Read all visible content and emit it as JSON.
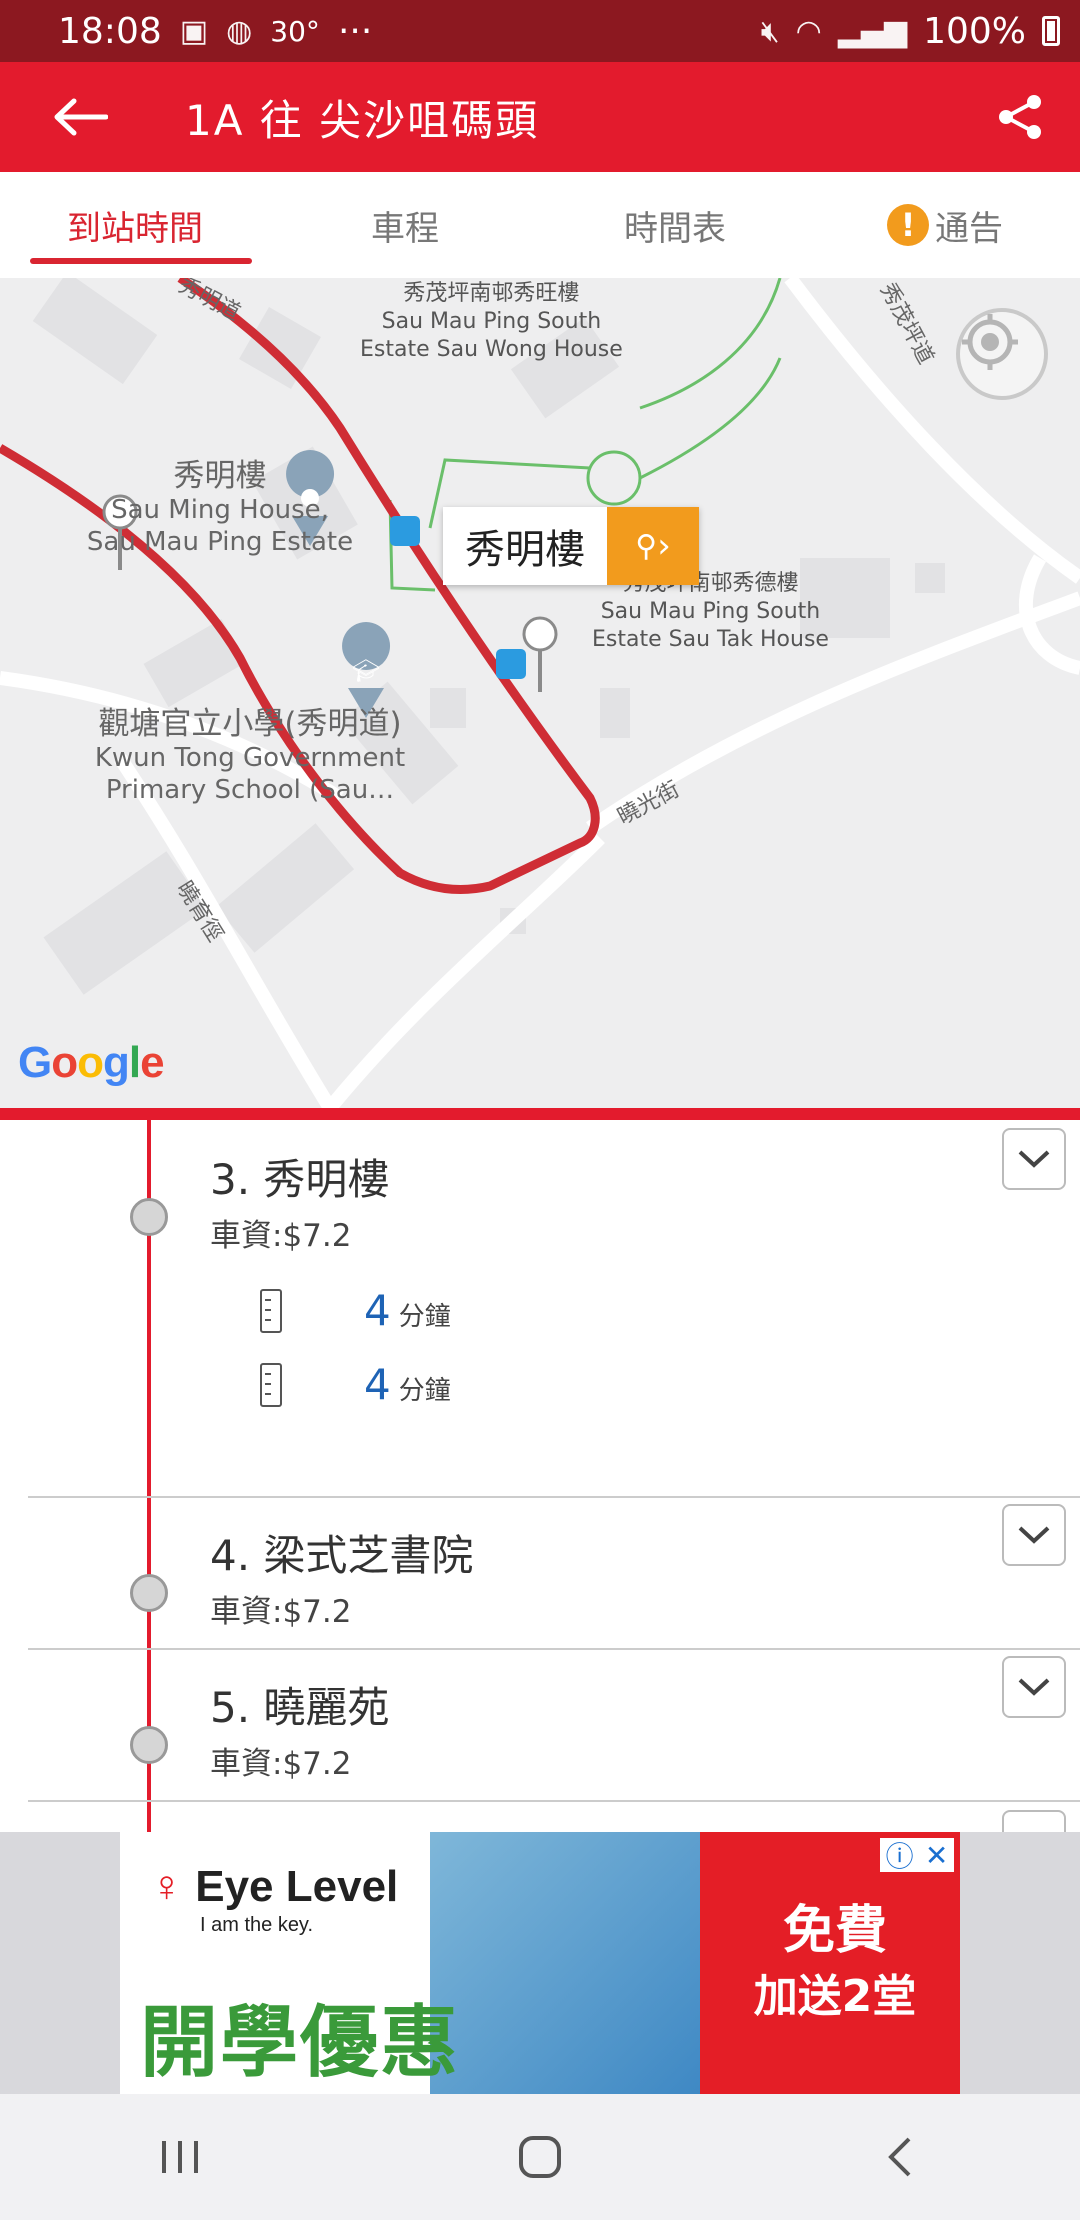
{
  "status_bar": {
    "time": "18:08",
    "temperature": "30°",
    "more": "···",
    "battery": "100%"
  },
  "app_bar": {
    "title": "1A 往 尖沙咀碼頭"
  },
  "tabs": [
    {
      "label": "到站時間",
      "active": true
    },
    {
      "label": "車程",
      "active": false
    },
    {
      "label": "時間表",
      "active": false
    },
    {
      "label": "通告",
      "active": false
    }
  ],
  "map": {
    "labels": {
      "sau_wong_zh": "秀茂坪南邨秀旺樓",
      "sau_wong_en1": "Sau Mau Ping South",
      "sau_wong_en2": "Estate Sau Wong House",
      "sau_ming_zh": "秀明樓",
      "sau_ming_en1": "Sau Ming House,",
      "sau_ming_en2": "Sau Mau Ping Estate",
      "sau_tak_zh": "秀茂坪南邨秀德樓",
      "sau_tak_en1": "Sau Mau Ping South",
      "sau_tak_en2": "Estate Sau Tak House",
      "school_zh": "觀塘官立小學(秀明道)",
      "school_en1": "Kwun Tong Government",
      "school_en2": "Primary School (Sau…",
      "road_sau_ming": "秀明道",
      "road_sau_mau_ping": "秀茂坪道",
      "road_hiu_kwong": "曉光街",
      "road_hiu_yuk": "曉育徑"
    },
    "callout": "秀明樓",
    "attribution": "Google"
  },
  "stops": [
    {
      "name": "3. 秀明樓",
      "fare": "車資:$7.2",
      "eta": [
        {
          "minutes": "4",
          "unit": "分鐘"
        },
        {
          "minutes": "4",
          "unit": "分鐘"
        }
      ]
    },
    {
      "name": "4. 梁式芝書院",
      "fare": "車資:$7.2"
    },
    {
      "name": "5. 曉麗苑",
      "fare": "車資:$7.2"
    }
  ],
  "ad": {
    "brand": "Eye Level",
    "tagline": "I am the key.",
    "headline": "開學優惠",
    "offer_line1": "免費",
    "offer_line2": "加送2堂"
  },
  "colors": {
    "status_bar": "#8c1820",
    "app_bar": "#e31b2d",
    "accent": "#d92531",
    "eta": "#1e63b5",
    "callout_button": "#f29b1d"
  }
}
